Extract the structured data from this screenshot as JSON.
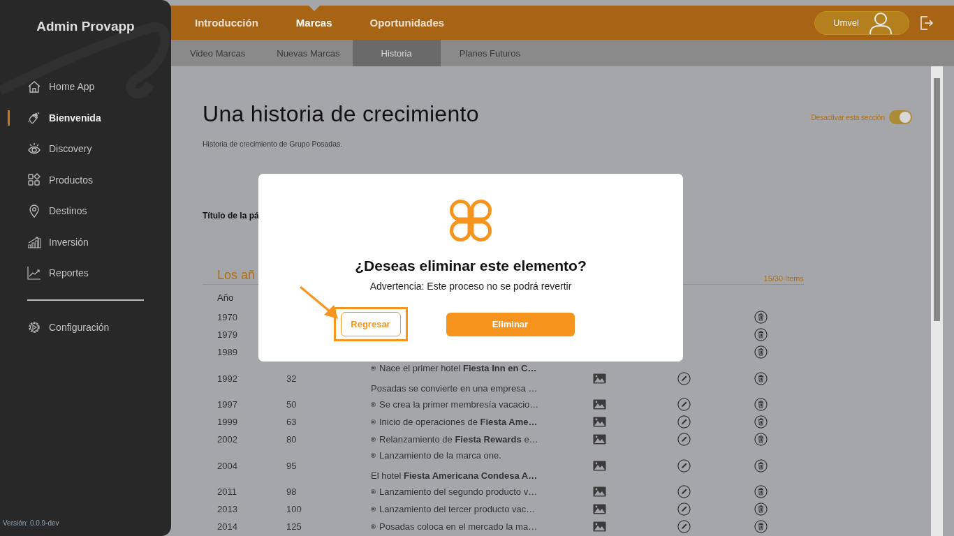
{
  "sidebar": {
    "brand": "Admin Provapp",
    "items": [
      {
        "label": "Home App",
        "selected": false
      },
      {
        "label": "Bienvenida",
        "selected": true
      },
      {
        "label": "Discovery",
        "selected": false
      },
      {
        "label": "Productos",
        "selected": false
      },
      {
        "label": "Destinos",
        "selected": false
      },
      {
        "label": "Inversión",
        "selected": false
      },
      {
        "label": "Reportes",
        "selected": false
      }
    ],
    "settings": {
      "label": "Configuración",
      "selected": false
    },
    "version": "Versión: 0.0.9-dev"
  },
  "top_nav": {
    "tabs": [
      {
        "label": "Introducción",
        "selected": false
      },
      {
        "label": "Marcas",
        "selected": true
      },
      {
        "label": "Oportunidades",
        "selected": false
      }
    ],
    "user": {
      "name": "Umvel"
    },
    "subtabs": [
      {
        "label": "Video Marcas",
        "selected": false
      },
      {
        "label": "Nuevas Marcas",
        "selected": false
      },
      {
        "label": "Historia",
        "selected": true
      },
      {
        "label": "Planes Futuros",
        "selected": false
      }
    ]
  },
  "page": {
    "title": "Una historia de crecimiento",
    "subtitle": "Historia de crecimiento de Grupo Posadas.",
    "section_toggle": {
      "label": "Desactivar esta sección",
      "on": true
    },
    "field_label": "Título de la pá",
    "list_title": "Los añ",
    "count": "15/30 ítems",
    "column_year": "Año",
    "rows": [
      {
        "year": "1970"
      },
      {
        "year": "1979"
      },
      {
        "year": "1989"
      },
      {
        "year": "1992",
        "value": "32",
        "lines": [
          {
            "kind": "bullet",
            "text": "Nace el primer hotel **Fiesta Inn en C…**"
          },
          {
            "kind": "plain",
            "text": "Posadas se convierte en una empresa …"
          }
        ]
      },
      {
        "year": "1997",
        "value": "50",
        "lines": [
          {
            "kind": "bullet",
            "text": "Se crea la primer membresía vacacio…"
          }
        ]
      },
      {
        "year": "1999",
        "value": "63",
        "lines": [
          {
            "kind": "bullet",
            "text": "Inicio de operaciones de **Fiesta Ame…**"
          }
        ]
      },
      {
        "year": "2002",
        "value": "80",
        "lines": [
          {
            "kind": "bullet",
            "text": "Relanzamiento de **Fiesta Rewards** e…"
          }
        ]
      },
      {
        "year": "2004",
        "value": "95",
        "lines": [
          {
            "kind": "bullet",
            "text": "Lanzamiento de la marca one."
          },
          {
            "kind": "plain",
            "text": "El hotel **Fiesta Americana Condesa A…**"
          }
        ]
      },
      {
        "year": "2011",
        "value": "98",
        "lines": [
          {
            "kind": "bullet",
            "text": "Lanzamiento del segundo producto v…"
          }
        ]
      },
      {
        "year": "2013",
        "value": "100",
        "lines": [
          {
            "kind": "bullet",
            "text": "Lanzamiento del tercer producto vac…"
          }
        ]
      },
      {
        "year": "2014",
        "value": "125",
        "lines": [
          {
            "kind": "bullet",
            "text": "Posadas coloca en el mercado la ma…"
          }
        ]
      }
    ]
  },
  "dialog": {
    "title": "¿Deseas eliminar este elemento?",
    "message": "Advertencia: Este proceso no se podrá revertir",
    "cancel": "Regresar",
    "confirm": "Eliminar"
  }
}
